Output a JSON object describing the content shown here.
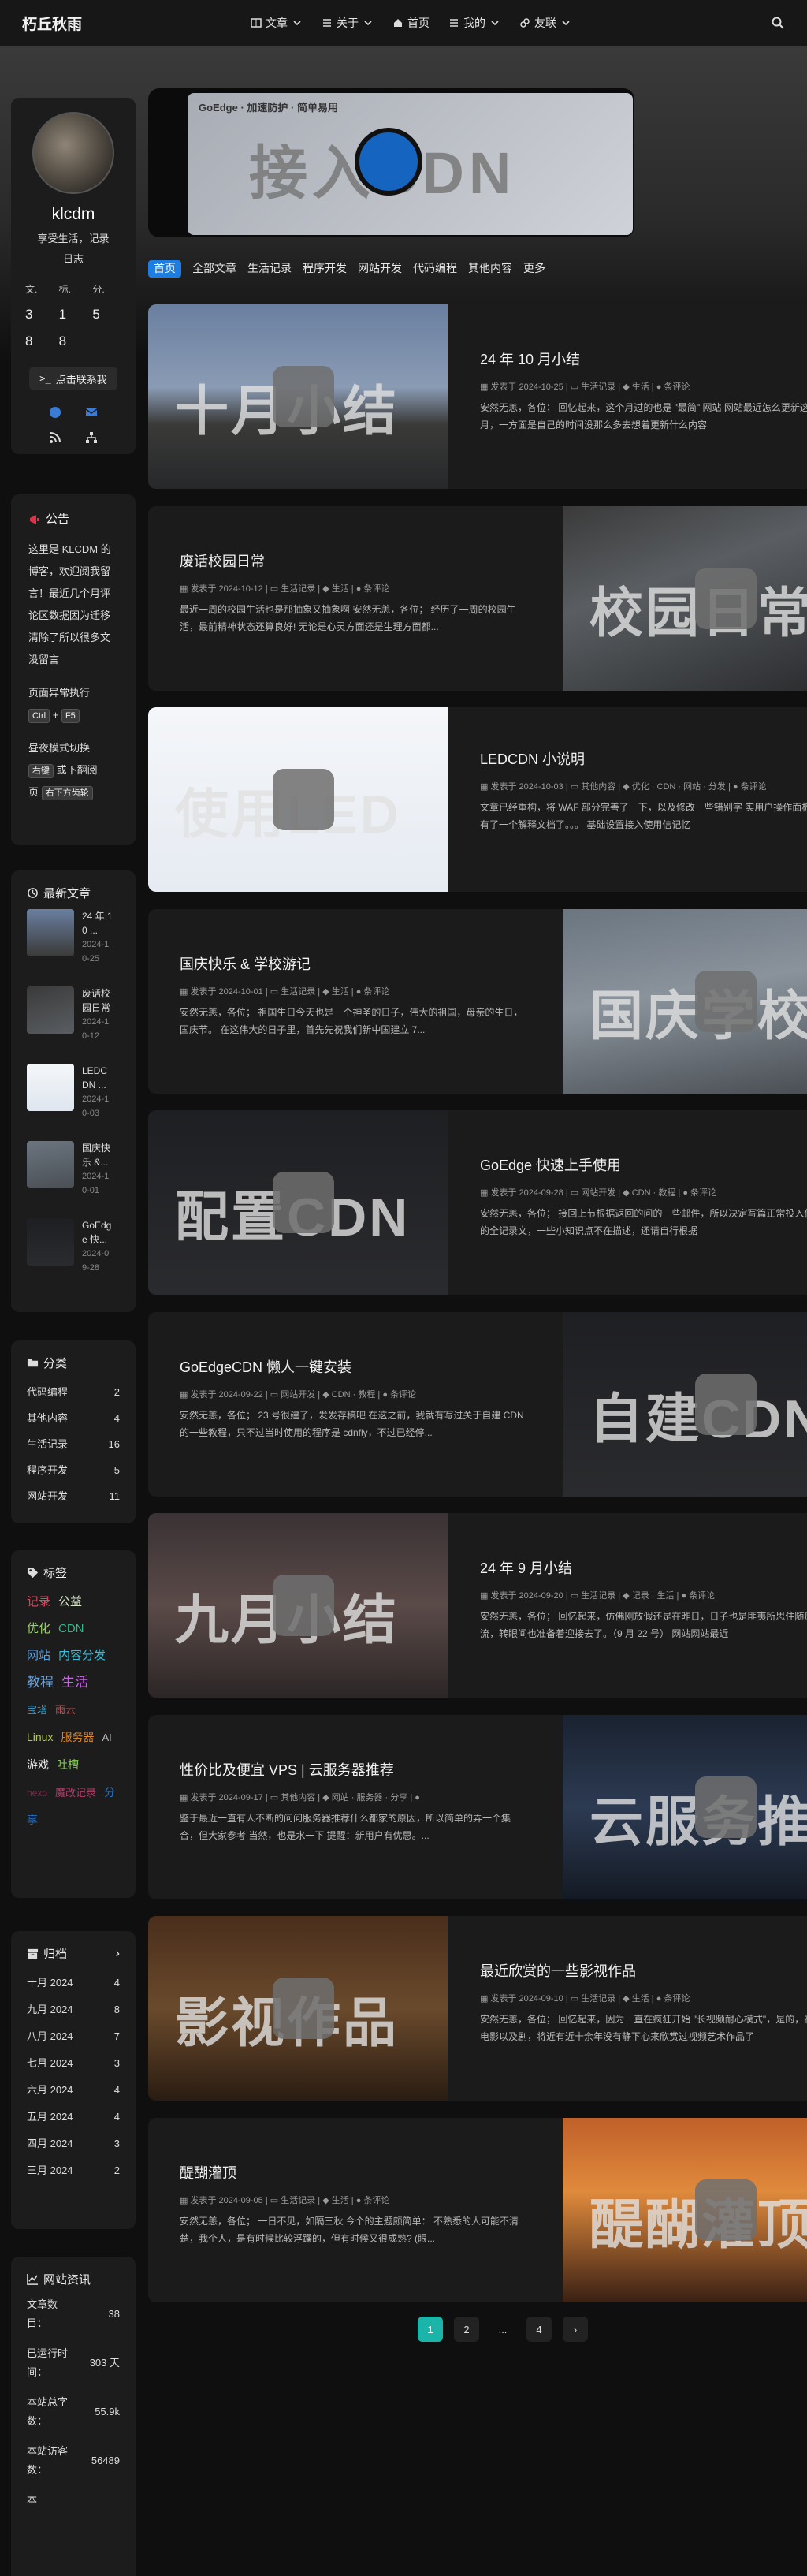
{
  "nav": {
    "brand": "朽丘秋雨",
    "items": [
      {
        "label": "文章",
        "icon": "book-icon",
        "dropdown": true
      },
      {
        "label": "关于",
        "icon": "list-icon",
        "dropdown": true
      },
      {
        "label": "首页",
        "icon": "home-icon",
        "dropdown": false
      },
      {
        "label": "我的",
        "icon": "list-icon",
        "dropdown": true
      },
      {
        "label": "友联",
        "icon": "link-icon",
        "dropdown": true
      }
    ]
  },
  "hero": {
    "overlay_text": "接入CDN",
    "banner_text": "GoEdge · 加速防护 · 简单易用"
  },
  "tabs": [
    "首页",
    "全部文章",
    "生活记录",
    "程序开发",
    "网站开发",
    "代码编程",
    "其他内容",
    "更多"
  ],
  "profile": {
    "name": "klcdm",
    "desc_line1": "享受生活，记录",
    "desc_line2": "日志",
    "stat_labels": [
      "文.",
      "标.",
      "分."
    ],
    "stat_values": [
      "3",
      "1",
      "5",
      "8",
      "8"
    ],
    "contact_label": "点击联系我"
  },
  "announce": {
    "title": "公告",
    "text": "这里是 KLCDM 的博客，欢迎阅我留言！最近几个月评论区数据因为迁移清除了所以很多文没留言",
    "fix_label": "页面异常执行",
    "keys": [
      "Ctrl",
      "F5"
    ],
    "theme_label": "昼夜模式切换",
    "key_right": "右键",
    "theme_suffix": "或下翻阅",
    "theme_prefix2": "页",
    "key_bottom": "右下方齿轮"
  },
  "recent": {
    "title": "最新文章",
    "items": [
      {
        "title": "24 年 10 ...",
        "date": "2024-10-25"
      },
      {
        "title": "废话校园日常",
        "date": "2024-10-12"
      },
      {
        "title": "LEDCDN ...",
        "date": "2024-10-03"
      },
      {
        "title": "国庆快乐 &...",
        "date": "2024-10-01"
      },
      {
        "title": "GoEdge 快...",
        "date": "2024-09-28"
      }
    ]
  },
  "categories": {
    "title": "分类",
    "items": [
      {
        "name": "代码编程",
        "count": "2"
      },
      {
        "name": "其他内容",
        "count": "4"
      },
      {
        "name": "生活记录",
        "count": "16"
      },
      {
        "name": "程序开发",
        "count": "5"
      },
      {
        "name": "网站开发",
        "count": "11"
      }
    ]
  },
  "tags": {
    "title": "标签",
    "items": [
      {
        "name": "记录",
        "color": "#e0475a"
      },
      {
        "name": "公益",
        "color": "#d7e8c8"
      },
      {
        "name": "优化",
        "color": "#9ad36a"
      },
      {
        "name": "CDN",
        "color": "#2fb98c"
      },
      {
        "name": "网站",
        "color": "#5aa0e6"
      },
      {
        "name": "内容分发",
        "color": "#34c0e0"
      },
      {
        "name": "教程",
        "color": "#6aa4e0"
      },
      {
        "name": "生活",
        "color": "#c368e0"
      },
      {
        "name": "宝塔",
        "color": "#2e9acc"
      },
      {
        "name": "雨云",
        "color": "#b25a5a"
      },
      {
        "name": "Linux",
        "color": "#b0cc4a"
      },
      {
        "name": "服务器",
        "color": "#e08a2c"
      },
      {
        "name": "AI",
        "color": "#bbbbbb"
      },
      {
        "name": "游戏",
        "color": "#e8e8e8"
      },
      {
        "name": "吐槽",
        "color": "#8acc5a"
      },
      {
        "name": "hexo",
        "color": "#7a2a48"
      },
      {
        "name": "魔改记录",
        "color": "#b0406a"
      },
      {
        "name": "分享",
        "color": "#2a70c0"
      }
    ]
  },
  "archive": {
    "title": "归档",
    "items": [
      {
        "month": "十月 2024",
        "count": "4"
      },
      {
        "month": "九月 2024",
        "count": "8"
      },
      {
        "month": "八月 2024",
        "count": "7"
      },
      {
        "month": "七月 2024",
        "count": "3"
      },
      {
        "month": "六月 2024",
        "count": "4"
      },
      {
        "month": "五月 2024",
        "count": "4"
      },
      {
        "month": "四月 2024",
        "count": "3"
      },
      {
        "month": "三月 2024",
        "count": "2"
      }
    ]
  },
  "siteinfo": {
    "title": "网站资讯",
    "rows": [
      {
        "label": "文章数目：",
        "value": "38"
      },
      {
        "label": "已运行时间：",
        "value": "303 天"
      },
      {
        "label": "本站总字数：",
        "value": "55.9k"
      },
      {
        "label": "本站访客数：",
        "value": "56489"
      },
      {
        "label": "本",
        "value": ""
      }
    ]
  },
  "posts": [
    {
      "title": "24 年 10 月小结",
      "date": "发表于 2024-10-25",
      "category": "生活记录",
      "tags": "生活",
      "comments": "条评论",
      "excerpt": "安然无恙，各位；  回忆起来，这个月过的也是 \"最简\" 网站 网站最近怎么更新这个月，一方面是自己的时间没那么多去想着更新什么内容",
      "img_text": "十月小结",
      "img_side": "left",
      "img_bg": "linear-gradient(180deg,#6a7fa0 0%,#8a9bb4 45%,#3a3a38 65%,#26282a 100%)"
    },
    {
      "title": "废话校园日常",
      "date": "发表于 2024-10-12",
      "category": "生活记录",
      "tags": "生活",
      "comments": "条评论",
      "excerpt": "最近一周的校园生活也是那抽象又抽象啊 安然无恙，各位；  经历了一周的校园生活，最前精神状态还算良好! 无论是心灵方面还是生理方面都...",
      "img_text": "校园日常",
      "img_side": "right",
      "img_bg": "linear-gradient(160deg,#3a3a3a 0%,#5a5e62 40%,#2c2e30 100%)"
    },
    {
      "title": "LEDCDN 小说明",
      "date": "发表于 2024-10-03",
      "category": "其他内容",
      "tags": "优化 · CDN · 网站 · 分发",
      "comments": "条评论",
      "excerpt": "文章已经重构，将 WAF 部分完善了一下，以及修改一些错别字 实用户操作面板碗有了一个解释文档了。。。 基础设置接入使用信记忆",
      "img_text": "使用LED",
      "img_side": "left",
      "img_bg": "linear-gradient(180deg,#f4f6f9 0%,#e6ebf2 100%)"
    },
    {
      "title": "国庆快乐 & 学校游记",
      "date": "发表于 2024-10-01",
      "category": "生活记录",
      "tags": "生活",
      "comments": "条评论",
      "excerpt": "安然无恙，各位；  祖国生日今天也是一个神圣的日子，伟大的祖国，母亲的生日，国庆节。 在这伟大的日子里，首先先祝我们新中国建立 7...",
      "img_text": "国庆学校",
      "img_side": "right",
      "img_bg": "linear-gradient(170deg,#6b7580 0%,#8a939c 45%,#4a4f54 100%)"
    },
    {
      "title": "GoEdge 快速上手使用",
      "date": "发表于 2024-09-28",
      "category": "网站开发",
      "tags": "CDN · 教程",
      "comments": "条评论",
      "excerpt": "安然无恙，各位；  接回上节根据返回的问的一些邮件，所以决定写篇正常投入使用的全记录文，一些小知识点不在描述，还请自行根据",
      "img_text": "配置CDN",
      "img_side": "left",
      "img_bg": "linear-gradient(180deg,#1e1f22 0%,#2a2b2e 100%)"
    },
    {
      "title": "GoEdgeCDN 懒人一键安装",
      "date": "发表于 2024-09-22",
      "category": "网站开发",
      "tags": "CDN · 教程",
      "comments": "条评论",
      "excerpt": "安然无恙，各位；  23 号很建了，发发存稿吧 在这之前，我就有写过关于自建 CDN 的一些教程，只不过当时使用的程序是 cdnfly，不过已经停...",
      "img_text": "自建CDN",
      "img_side": "right",
      "img_bg": "linear-gradient(180deg,#1e1f22 0%,#2a2b2e 100%)"
    },
    {
      "title": "24 年 9 月小结",
      "date": "发表于 2024-09-20",
      "category": "生活记录",
      "tags": "记录 · 生活",
      "comments": "条评论",
      "excerpt": "安然无恙，各位；  回忆起来，仿佛刚放假还是在昨日，日子也是匪夷所思住随风送流，转眼间也准备着迎接去了。（9 月 22 号） 网站网站最近",
      "img_text": "九月小结",
      "img_side": "left",
      "img_bg": "linear-gradient(180deg,#3a3234 0%,#5a4a48 50%,#2c2626 100%)"
    },
    {
      "title": "性价比及便宜 VPS | 云服务器推荐",
      "date": "发表于 2024-09-17",
      "category": "其他内容",
      "tags": "网站 · 服务器 · 分享",
      "comments": "",
      "excerpt": "鉴于最近一直有人不断的问问服务器推荐什么都家的原因，所以简单的弄一个集合，但大家参考 当然，也是水一下 提醒：新用户有优惠。...",
      "img_text": "云服务推荐",
      "img_side": "right",
      "img_bg": "linear-gradient(180deg,#1a2230 0%,#2c3a52 50%,#141a24 100%)"
    },
    {
      "title": "最近欣赏的一些影视作品",
      "date": "发表于 2024-09-10",
      "category": "生活记录",
      "tags": "生活",
      "comments": "条评论",
      "excerpt": "安然无恙，各位；  回忆起来，因为一直在疯狂开始 \"长视频耐心模式\"，是的，在看电影以及剧，将近有近十余年没有静下心来欣赏过视频艺术作品了",
      "img_text": "影视作品",
      "img_side": "left",
      "img_bg": "linear-gradient(180deg,#4a2e1c 0%,#6a4a2c 50%,#2a1c12 100%)"
    },
    {
      "title": "醍醐灌顶",
      "date": "发表于 2024-09-05",
      "category": "生活记录",
      "tags": "生活",
      "comments": "条评论",
      "excerpt": "安然无恙，各位；  一日不见，如隔三秋 今个的主题颇简单： 不熟悉的人可能不清楚，我个人，是有时候比较浮躁的，但有时候又很成熟? (眼...",
      "img_text": "醍醐灌顶",
      "img_side": "right",
      "img_bg": "linear-gradient(180deg,#c0602a 0%,#e08a3c 40%,#3a2014 100%)"
    }
  ],
  "pagination": [
    "1",
    "2",
    "...",
    "4"
  ]
}
